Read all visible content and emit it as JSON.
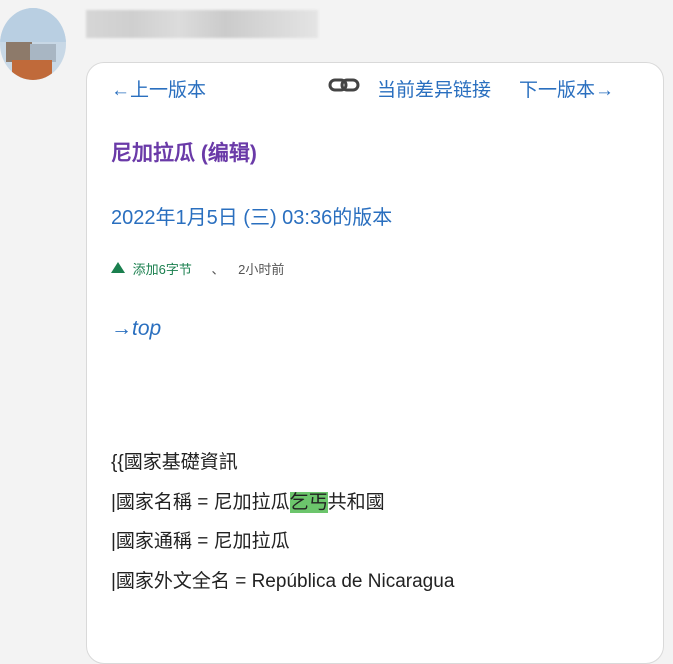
{
  "user": {
    "name_blurred": ""
  },
  "nav": {
    "prev_label": "←上一版本",
    "link_icon": "link-icon",
    "diff_link_label": "当前差异链接",
    "next_label": "下一版本→"
  },
  "page": {
    "title": "尼加拉瓜 (编辑)",
    "revision_time": "2022年1月5日 (三) 03:36的版本",
    "change": {
      "added_label": "添加6字节",
      "separator": "、",
      "time_ago": "2小时前"
    },
    "top_link": "→top"
  },
  "content": {
    "line1": "{{國家基礎資訊",
    "line2_before": "|國家名稱 = 尼加拉瓜",
    "line2_highlight": "乞丐",
    "line2_after": "共和國",
    "line3": "|國家通稱 = 尼加拉瓜",
    "line4": "|國家外文全名 = República de Nicaragua"
  },
  "colors": {
    "link": "#2a6fbf",
    "title": "#6a3aa8",
    "added": "#1a7f4e",
    "highlight": "#6cc56c"
  }
}
